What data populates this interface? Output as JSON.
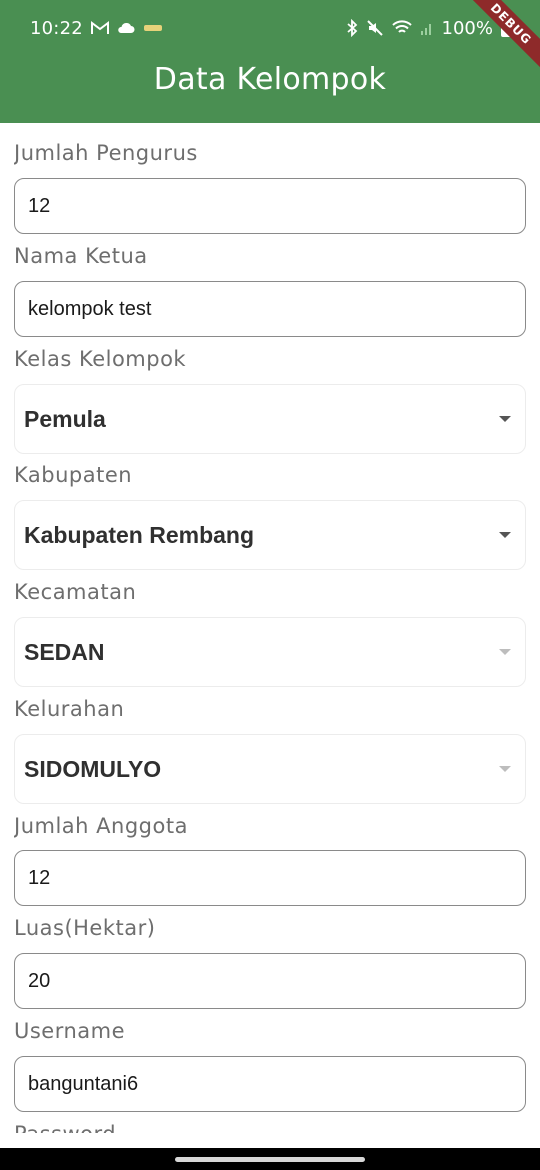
{
  "status_bar": {
    "time": "10:22",
    "battery_text": "100%",
    "left_icons": [
      "gmail-icon",
      "cloud-icon",
      "app-notification-icon"
    ],
    "right_icons": [
      "bluetooth-icon",
      "mute-icon",
      "wifi-icon",
      "signal-icon",
      "battery-icon"
    ]
  },
  "appbar": {
    "title": "Data Kelompok",
    "color": "#4a8f52"
  },
  "debug_banner": "DEBUG",
  "form": {
    "jumlah_pengurus": {
      "label": "Jumlah Pengurus",
      "value": "12"
    },
    "nama_ketua": {
      "label": "Nama Ketua",
      "value": "kelompok test"
    },
    "kelas_kelompok": {
      "label": "Kelas Kelompok",
      "value": "Pemula"
    },
    "kabupaten": {
      "label": "Kabupaten",
      "value": "Kabupaten Rembang"
    },
    "kecamatan": {
      "label": "Kecamatan",
      "value": "SEDAN"
    },
    "kelurahan": {
      "label": "Kelurahan",
      "value": "SIDOMULYO"
    },
    "jumlah_anggota": {
      "label": "Jumlah Anggota",
      "value": "12"
    },
    "luas": {
      "label": "Luas(Hektar)",
      "value": "20"
    },
    "username": {
      "label": "Username",
      "value": "banguntani6"
    },
    "password": {
      "label": "Password"
    }
  }
}
